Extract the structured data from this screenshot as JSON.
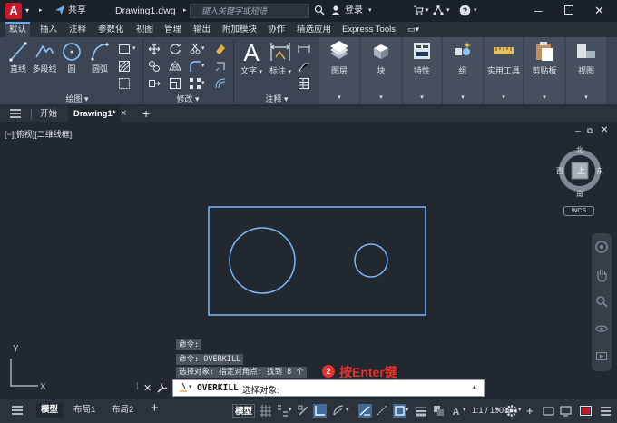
{
  "titlebar": {
    "app_logo": "A",
    "share_label": "共享",
    "doc_title": "Drawing1.dwg",
    "search_placeholder": "键入关键字或短语",
    "login_label": "登录"
  },
  "ribbon_tabs": [
    "默认",
    "插入",
    "注释",
    "参数化",
    "视图",
    "管理",
    "输出",
    "附加模块",
    "协作",
    "精选应用",
    "Express Tools"
  ],
  "ribbon": {
    "draw": {
      "title": "绘图",
      "line": "直线",
      "polyline": "多段线",
      "circle": "圆",
      "arc": "圆弧"
    },
    "modify": {
      "title": "修改"
    },
    "annotation": {
      "title": "注释",
      "text": "文字",
      "dimension": "标注"
    },
    "layers": "图层",
    "block": "块",
    "properties": "特性",
    "groups": "组",
    "utilities": "实用工具",
    "clipboard": "剪贴板",
    "view": "视图"
  },
  "file_tabs": {
    "start": "开始",
    "drawing": "Drawing1*",
    "close": "×",
    "add": "+"
  },
  "viewport": {
    "label": "[−][俯视][二维线框]",
    "viewcube": {
      "north": "北",
      "south": "南",
      "east": "东",
      "west": "西",
      "top": "上",
      "wcs": "WCS"
    },
    "ucs": {
      "x": "X",
      "y": "Y"
    }
  },
  "command": {
    "history": [
      "命令:",
      "命令: OVERKILL",
      "选择对象: 指定对角点: 找到 8 个"
    ],
    "current_cmd": "OVERKILL",
    "prompt": "选择对象:",
    "annotation_badge": "2",
    "annotation_text": "按Enter键"
  },
  "statusbar": {
    "layout_tabs": [
      "模型",
      "布局1",
      "布局2"
    ],
    "model_label": "模型",
    "scale": "1:1 / 100%"
  },
  "colors": {
    "accent": "#6aa8e8",
    "annotation_red": "#e8322e",
    "drawing_line": "#7ab8ff",
    "logo_red": "#c8192b"
  }
}
